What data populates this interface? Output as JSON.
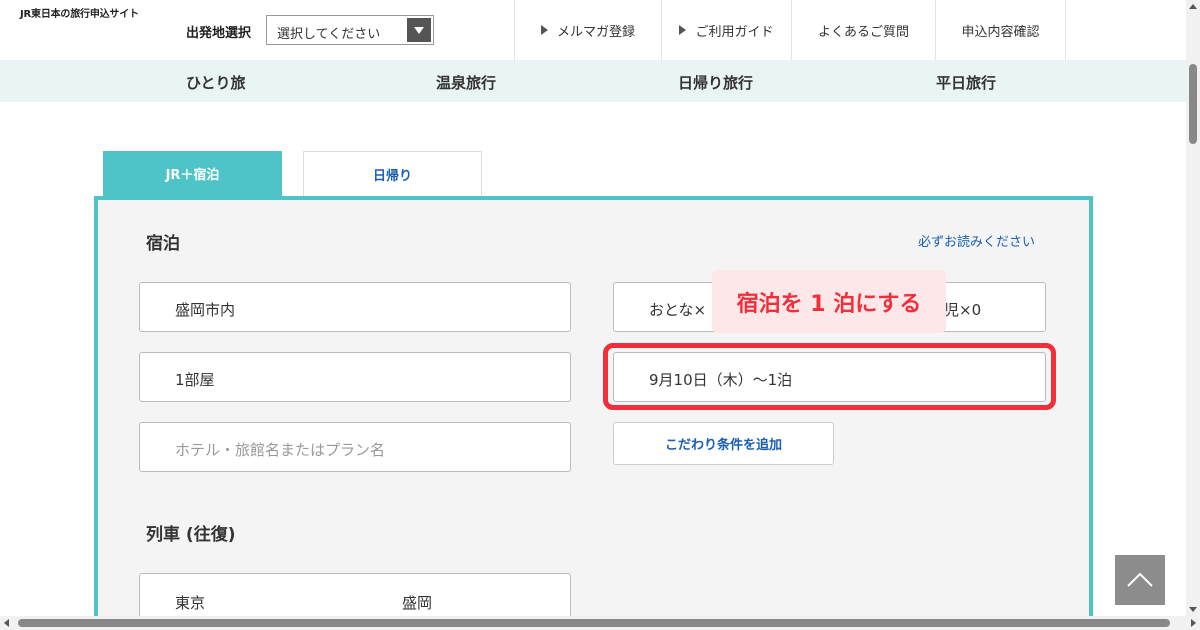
{
  "header": {
    "brand": "JR東日本の旅行申込サイト",
    "departure_label": "出発地選択",
    "departure_select_value": "選択してください",
    "links": [
      "メルマガ登録",
      "ご利用ガイド",
      "よくあるご質問",
      "申込内容確認"
    ]
  },
  "category_nav": [
    "ひとり旅",
    "温泉旅行",
    "日帰り旅行",
    "平日旅行"
  ],
  "tabs": [
    {
      "label": "JR＋宿泊",
      "active": true
    },
    {
      "label": "日帰り",
      "active": false
    }
  ],
  "lodging": {
    "title": "宿泊",
    "notice_link": "必ずお読みください",
    "area": "盛岡市内",
    "guests_prefix": "おとな×",
    "guests_suffix": "児×0",
    "rooms": "1部屋",
    "dates": "9月10日（木）〜1泊",
    "hotel_placeholder": "ホテル・旅館名またはプラン名",
    "add_conditions_button": "こだわり条件を追加"
  },
  "train": {
    "title": "列車 (往復)",
    "origin": "東京",
    "destination": "盛岡"
  },
  "annotation": {
    "callout": "宿泊を 1 泊にする",
    "color": "#f22e3a"
  },
  "colors": {
    "accent": "#4ec4c8",
    "link": "#1a5fb4",
    "nav_bg": "#e8f5f4"
  }
}
